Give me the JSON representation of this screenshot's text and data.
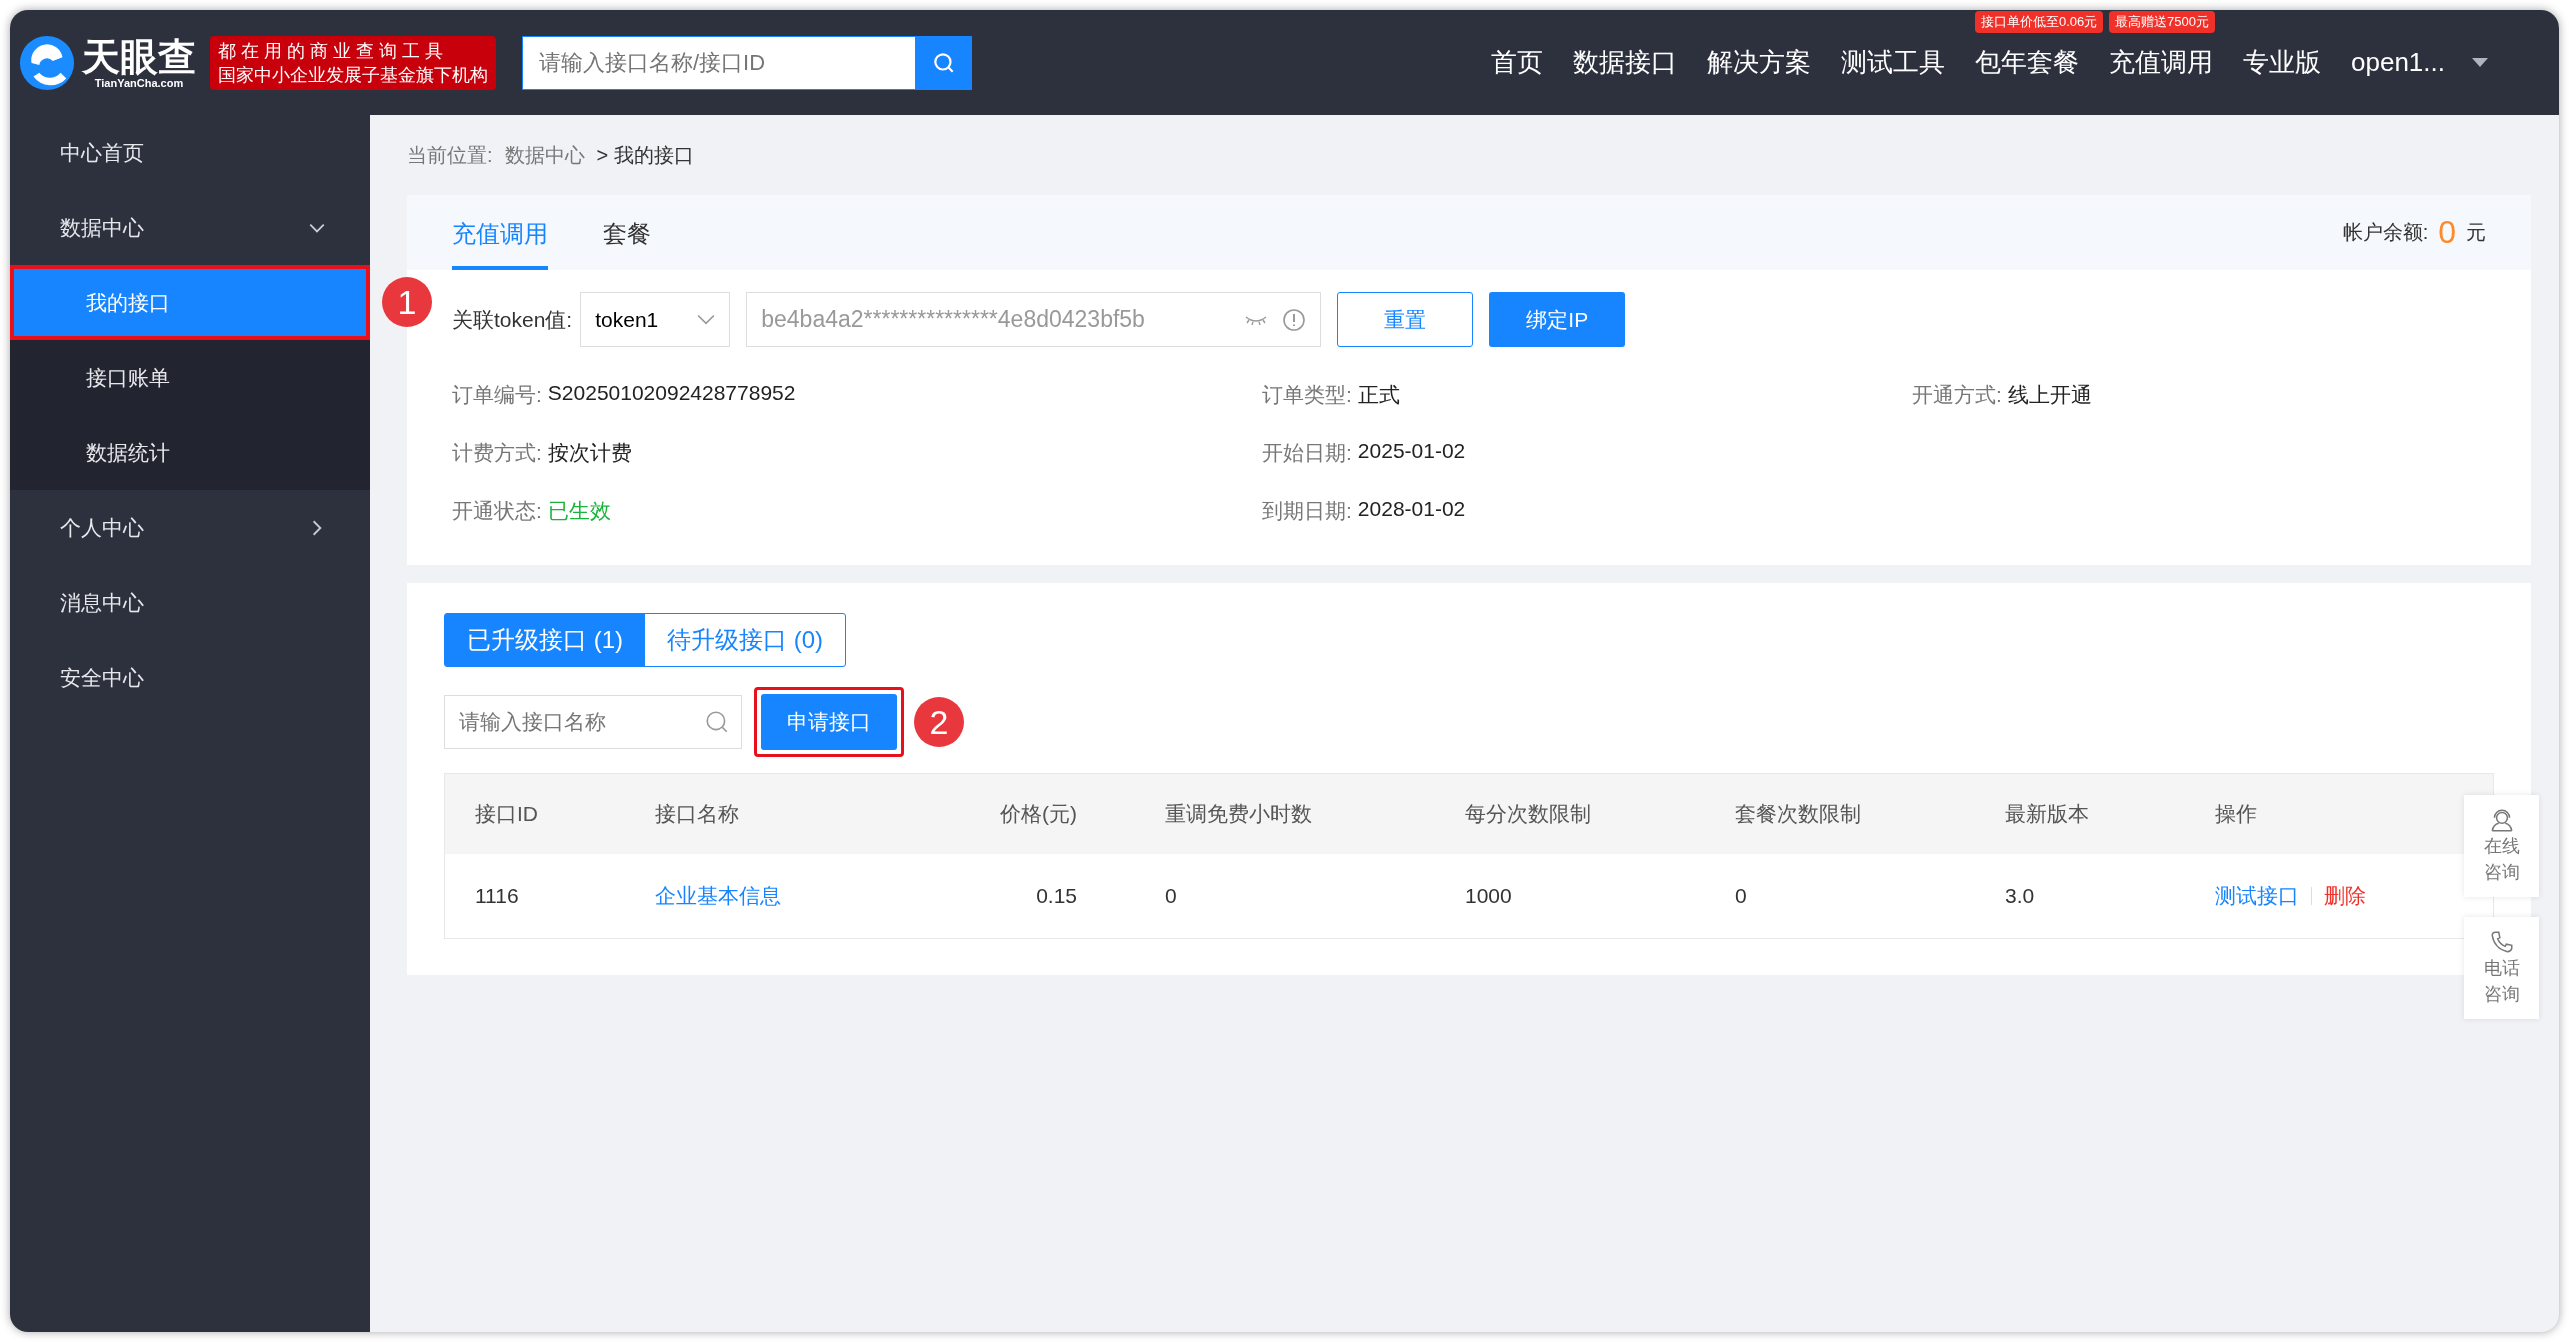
{
  "header": {
    "logo_text": "天眼查",
    "logo_subtext": "TianYanCha.com",
    "slogan": [
      "都 在 用 的 商 业 查 询 工 具",
      "国家中小企业发展子基金旗下机构"
    ],
    "search": {
      "placeholder": "请输入接口名称/接口ID"
    },
    "nav": [
      {
        "label": "首页"
      },
      {
        "label": "数据接口"
      },
      {
        "label": "解决方案"
      },
      {
        "label": "测试工具"
      },
      {
        "label": "包年套餐",
        "badge": "接口单价低至0.06元"
      },
      {
        "label": "充值调用",
        "badge": "最高赠送7500元"
      },
      {
        "label": "专业版"
      }
    ],
    "user": "open1..."
  },
  "sidebar": {
    "items": [
      {
        "label": "中心首页"
      },
      {
        "label": "数据中心",
        "expanded": true,
        "children": [
          {
            "label": "我的接口",
            "selected": true,
            "highlighted": true,
            "marker": "1"
          },
          {
            "label": "接口账单",
            "selected": false,
            "highlighted": false
          },
          {
            "label": "数据统计",
            "selected": false,
            "highlighted": false
          }
        ]
      },
      {
        "label": "个人中心",
        "expanded": false
      },
      {
        "label": "消息中心"
      },
      {
        "label": "安全中心"
      }
    ]
  },
  "breadcrumb": {
    "prefix": "当前位置:",
    "items": [
      "数据中心",
      "> 我的接口"
    ]
  },
  "tabs": [
    {
      "label": "充值调用",
      "selected": true
    },
    {
      "label": "套餐",
      "selected": false
    }
  ],
  "balance": {
    "label": "帐户余额:",
    "value": "0",
    "unit": "元"
  },
  "token": {
    "label": "关联token值:",
    "select": "token1",
    "value": "be4ba4a2***************4e8d0423bf5b",
    "buttons": [
      {
        "label": "重置",
        "kind": "outline"
      },
      {
        "label": "绑定IP",
        "kind": "primary"
      }
    ]
  },
  "info_columns": [
    [
      {
        "label": "订单编号:",
        "value": "S20250102092428778952",
        "status": false
      },
      {
        "label": "计费方式:",
        "value": "按次计费",
        "status": false
      },
      {
        "label": "开通状态:",
        "value": "已生效",
        "status": true
      }
    ],
    [
      {
        "label": "订单类型:",
        "value": "正式",
        "status": false
      },
      {
        "label": "开始日期:",
        "value": "2025-01-02",
        "status": false
      },
      {
        "label": "到期日期:",
        "value": "2028-01-02",
        "status": false
      }
    ],
    [
      {
        "label": "开通方式:",
        "value": "线上开通",
        "status": false
      }
    ]
  ],
  "sub_tabs": [
    {
      "label": "已升级接口 (1)",
      "selected": true
    },
    {
      "label": "待升级接口 (0)",
      "selected": false
    }
  ],
  "api_search": {
    "placeholder": "请输入接口名称"
  },
  "apply_button": {
    "label": "申请接口",
    "highlighted": true,
    "marker": "2"
  },
  "table": {
    "columns": [
      "接口ID",
      "接口名称",
      "价格(元)",
      "重调免费小时数",
      "每分次数限制",
      "套餐次数限制",
      "最新版本",
      "操作"
    ],
    "rows": [
      {
        "cells": [
          "1116",
          "企业基本信息",
          "0.15",
          "0",
          "1000",
          "0",
          "3.0"
        ],
        "actions": [
          {
            "label": "测试接口",
            "kind": "link"
          },
          {
            "label": "删除",
            "kind": "danger"
          }
        ]
      }
    ]
  },
  "float_buttons": [
    {
      "label": "在线咨询",
      "kind": "chat"
    },
    {
      "label": "电话咨询",
      "kind": "phone"
    }
  ]
}
